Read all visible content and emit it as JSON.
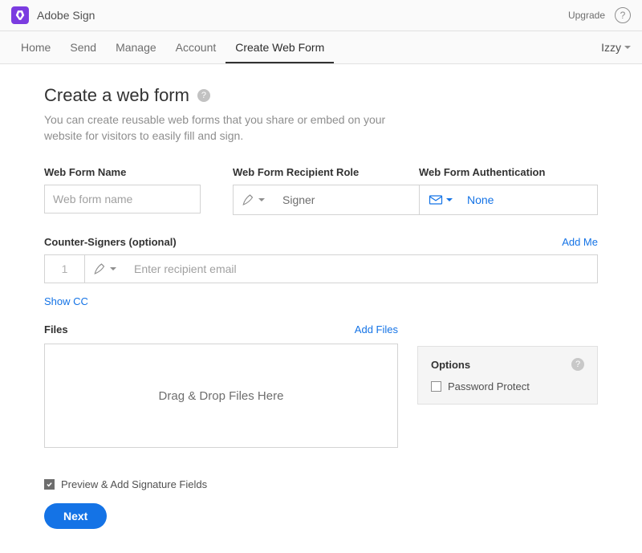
{
  "topbar": {
    "app_name": "Adobe Sign",
    "upgrade_label": "Upgrade"
  },
  "tabbar": {
    "tabs": [
      {
        "label": "Home"
      },
      {
        "label": "Send"
      },
      {
        "label": "Manage"
      },
      {
        "label": "Account"
      },
      {
        "label": "Create Web Form",
        "active": true
      }
    ],
    "user": "Izzy"
  },
  "page": {
    "title": "Create a web form",
    "description": "You can create reusable web forms that you share or embed on your website for visitors to easily fill and sign."
  },
  "form": {
    "name_label": "Web Form Name",
    "name_placeholder": "Web form name",
    "role_label": "Web Form Recipient Role",
    "role_value": "Signer",
    "auth_label": "Web Form Authentication",
    "auth_value": "None"
  },
  "counter": {
    "label": "Counter-Signers (optional)",
    "add_me": "Add Me",
    "index": "1",
    "placeholder": "Enter recipient email",
    "show_cc": "Show CC"
  },
  "files": {
    "label": "Files",
    "add_files": "Add Files",
    "dropzone_text": "Drag & Drop Files Here"
  },
  "options": {
    "title": "Options",
    "password_protect": "Password Protect"
  },
  "footer": {
    "preview_label": "Preview & Add Signature Fields",
    "next_label": "Next"
  }
}
